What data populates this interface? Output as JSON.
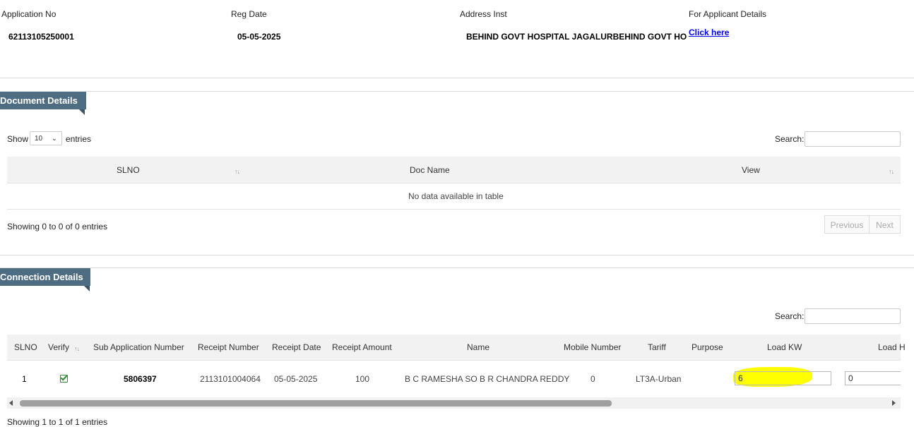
{
  "header": {
    "app_no_label": "Application No",
    "app_no_value": "62113105250001",
    "reg_date_label": "Reg Date",
    "reg_date_value": "05-05-2025",
    "address_label": "Address Inst",
    "address_value": "BEHIND GOVT HOSPITAL JAGALURBEHIND GOVT HO",
    "applicant_label": "For Applicant Details",
    "applicant_link": "Click here"
  },
  "documents": {
    "title": "Document Details",
    "show_label": "Show",
    "page_size": "10",
    "entries_label": "entries",
    "search_label": "Search:",
    "columns": [
      "SLNO",
      "Doc Name",
      "View"
    ],
    "empty_message": "No data available in table",
    "info": "Showing 0 to 0 of 0 entries",
    "prev_label": "Previous",
    "next_label": "Next"
  },
  "connections": {
    "title": "Connection Details",
    "search_label": "Search:",
    "columns": [
      "SLNO",
      "Verify",
      "Sub Application Number",
      "Receipt Number",
      "Receipt Date",
      "Receipt Amount",
      "Name",
      "Mobile Number",
      "Tariff",
      "Purpose",
      "Load KW",
      "Load H"
    ],
    "rows": [
      {
        "slno": "1",
        "verified": true,
        "sub_app_no": "5806397",
        "receipt_no": "2113101004064",
        "receipt_date": "05-05-2025",
        "receipt_amount": "100",
        "name": "B C RAMESHA SO B R CHANDRA REDDY",
        "mobile": "0",
        "tariff": "LT3A-Urban",
        "purpose": "",
        "load_kw": "6",
        "load_h": "0"
      }
    ],
    "info": "Showing 1 to 1 of 1 entries"
  },
  "colors": {
    "ribbon": "#4f6d82",
    "highlight": "#ffff00",
    "link": "#0000ee",
    "check": "#2e8b2e"
  }
}
